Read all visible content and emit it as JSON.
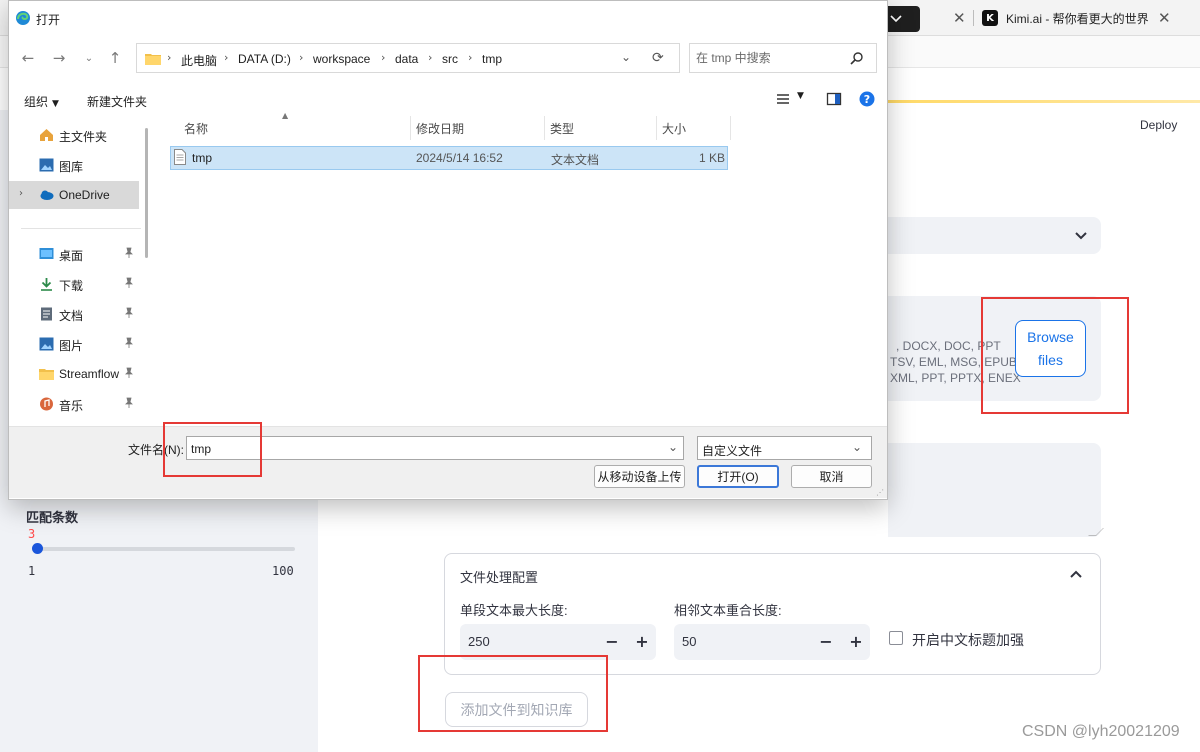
{
  "browser": {
    "tab_title": "Kimi.ai - 帮你看更大的世界"
  },
  "app": {
    "deploy_label": "Deploy",
    "uploader": {
      "types_line1": ", DOCX, DOC, PPT",
      "types_line2": "TSV, EML, MSG, EPUB,",
      "types_line3": "XML, PPT, PPTX, ENEX",
      "browse_line1": "Browse",
      "browse_line2": "files"
    },
    "sidebar": {
      "match_label": "匹配条数",
      "slider_value": "3",
      "slider_min": "1",
      "slider_max": "100",
      "slider_fraction": 0.0202
    },
    "config": {
      "title": "文件处理配置",
      "chunk_label": "单段文本最大长度:",
      "chunk_value": "250",
      "overlap_label": "相邻文本重合长度:",
      "overlap_value": "50",
      "zh_title_label": "开启中文标题加强"
    },
    "add_button": "添加文件到知识库",
    "watermark": "CSDN @lyh20021209"
  },
  "dialog": {
    "title": "打开",
    "breadcrumb": [
      "此电脑",
      "DATA (D:)",
      "workspace",
      "data",
      "src",
      "tmp"
    ],
    "search_placeholder": "在 tmp 中搜索",
    "toolbar": {
      "organize": "组织",
      "new_folder": "新建文件夹"
    },
    "nav": {
      "home": "主文件夹",
      "gallery": "图库",
      "onedrive": "OneDrive",
      "desktop": "桌面",
      "downloads": "下载",
      "documents": "文档",
      "pictures": "图片",
      "streamflow": "Streamflow",
      "music": "音乐"
    },
    "columns": {
      "name": "名称",
      "modified": "修改日期",
      "type": "类型",
      "size": "大小"
    },
    "files": [
      {
        "name": "tmp",
        "modified": "2024/5/14 16:52",
        "type": "文本文档",
        "size": "1 KB"
      }
    ],
    "filename_label": "文件名(N):",
    "filename_value": "tmp",
    "filetype": "自定义文件",
    "upload_mobile": "从移动设备上传",
    "open": "打开(O)",
    "cancel": "取消"
  },
  "colors": {
    "highlight_box": "#e53935",
    "accent": "#1a73e8",
    "slider_value": "#ff4b4b"
  }
}
